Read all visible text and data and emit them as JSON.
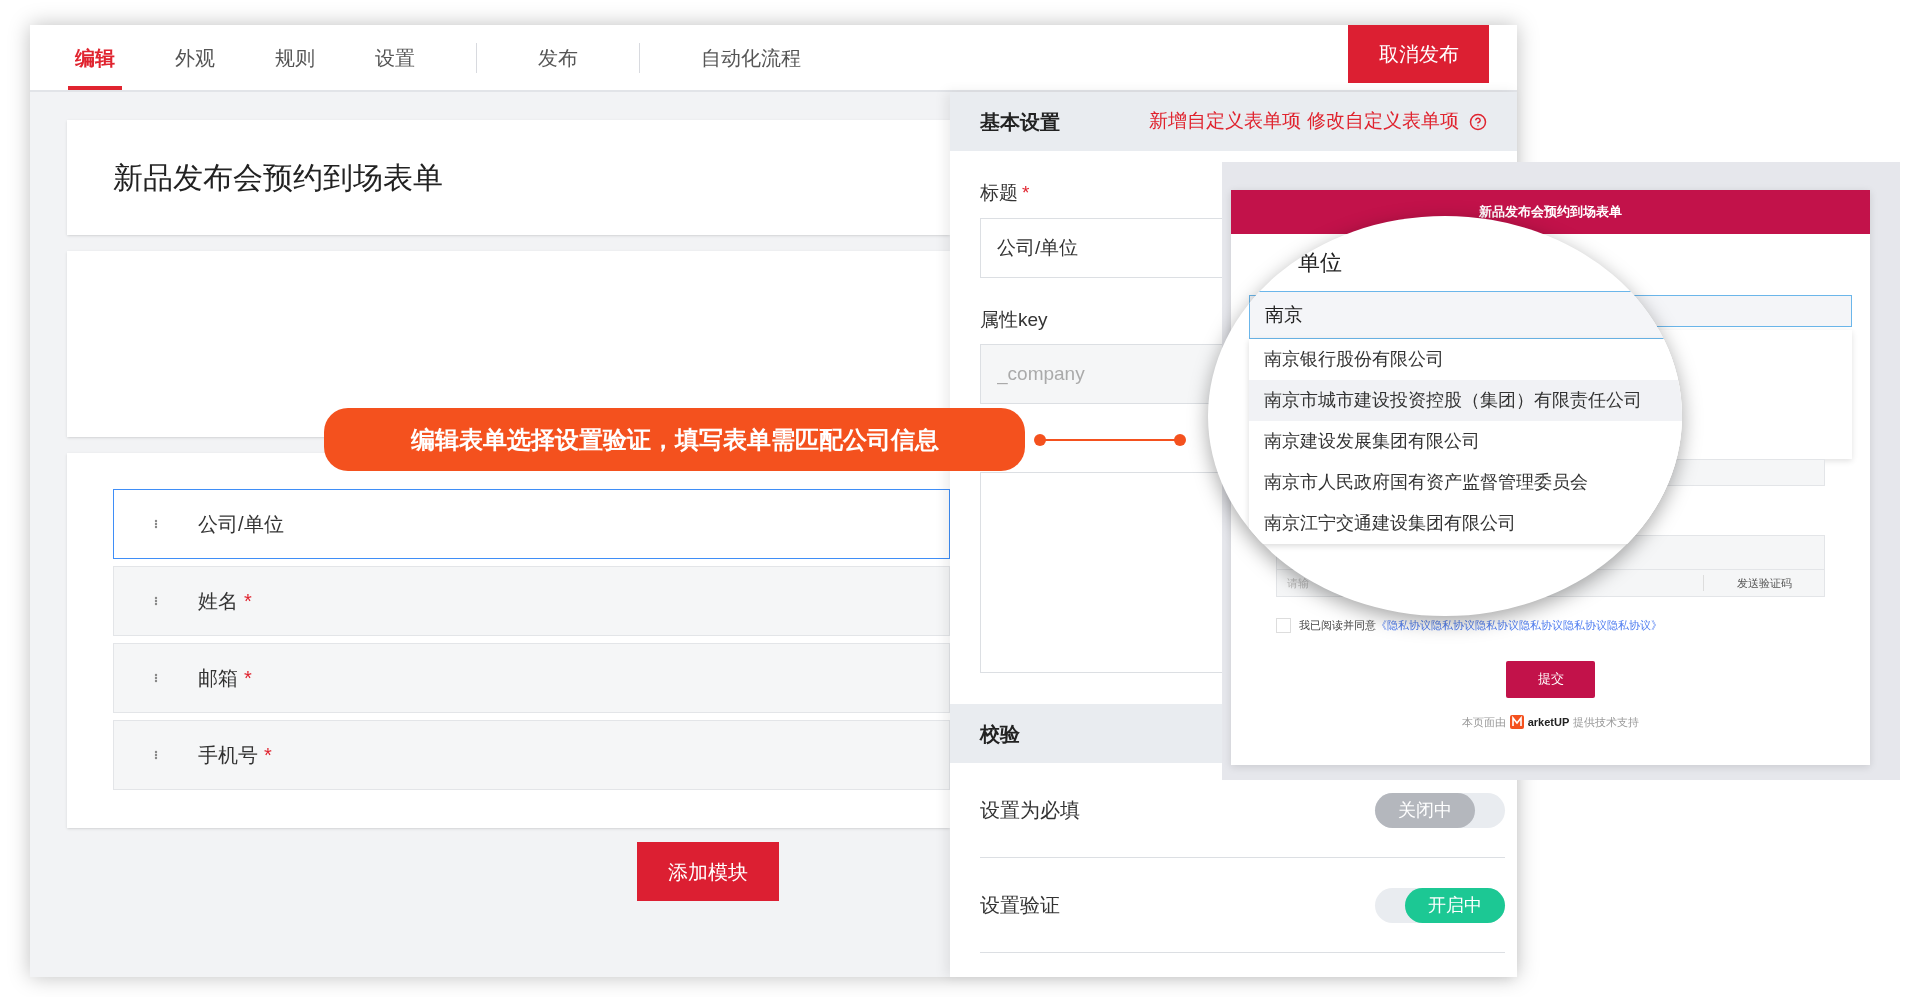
{
  "tab_groups": [
    [
      {
        "label": "编辑",
        "selected": true
      },
      {
        "label": "外观",
        "selected": false
      },
      {
        "label": "规则",
        "selected": false
      },
      {
        "label": "设置",
        "selected": false
      }
    ],
    [
      {
        "label": "发布",
        "selected": false
      }
    ],
    [
      {
        "label": "自动化流程",
        "selected": false
      }
    ]
  ],
  "cancel_button": "取消发布",
  "required_marker": "*",
  "form_title": "新品发布会预约到场表单",
  "fields": [
    {
      "label": "公司/单位",
      "required": false,
      "selected": true
    },
    {
      "label": "姓名",
      "required": true,
      "selected": false
    },
    {
      "label": "邮箱",
      "required": true,
      "selected": false
    },
    {
      "label": "手机号",
      "required": true,
      "selected": false
    }
  ],
  "add_button": "添加模块",
  "callout": "编辑表单选择设置验证，填写表单需匹配公司信息",
  "settings": {
    "header": "基本设置",
    "links": [
      "新增自定义表单项",
      "修改自定义表单项"
    ],
    "title_label": "标题",
    "title_required": true,
    "title_value": "公司/单位",
    "key_label": "属性key",
    "key_value": "_company"
  },
  "validation": {
    "header": "校验",
    "toggles": [
      {
        "label": "设置为必填",
        "on": false,
        "text": "关闭中"
      },
      {
        "label": "设置验证",
        "on": true,
        "text": "开启中"
      }
    ]
  },
  "preview": {
    "title": "新品发布会预约到场表单",
    "code_placeholder": "请输",
    "send_code": "发送验证码",
    "agree_checked": false,
    "agree_text": "我已阅读并同意",
    "agree_link": "《隐私协议隐私协议隐私协议隐私协议隐私协议隐私协议》",
    "submit": "提交",
    "footer_before": "本页面由",
    "brand": "arketUP",
    "footer_after": "提供技术支持"
  },
  "magnifier": {
    "label": "单位",
    "search_value": "南京",
    "options": [
      {
        "label": "南京银行股份有限公司",
        "selected": false
      },
      {
        "label": "南京市城市建设投资控股（集团）有限责任公司",
        "selected": true
      },
      {
        "label": "南京建设发展集团有限公司",
        "selected": false
      },
      {
        "label": "南京市人民政府国有资产监督管理委员会",
        "selected": false
      },
      {
        "label": "南京江宁交通建设集团有限公司",
        "selected": false
      }
    ]
  }
}
